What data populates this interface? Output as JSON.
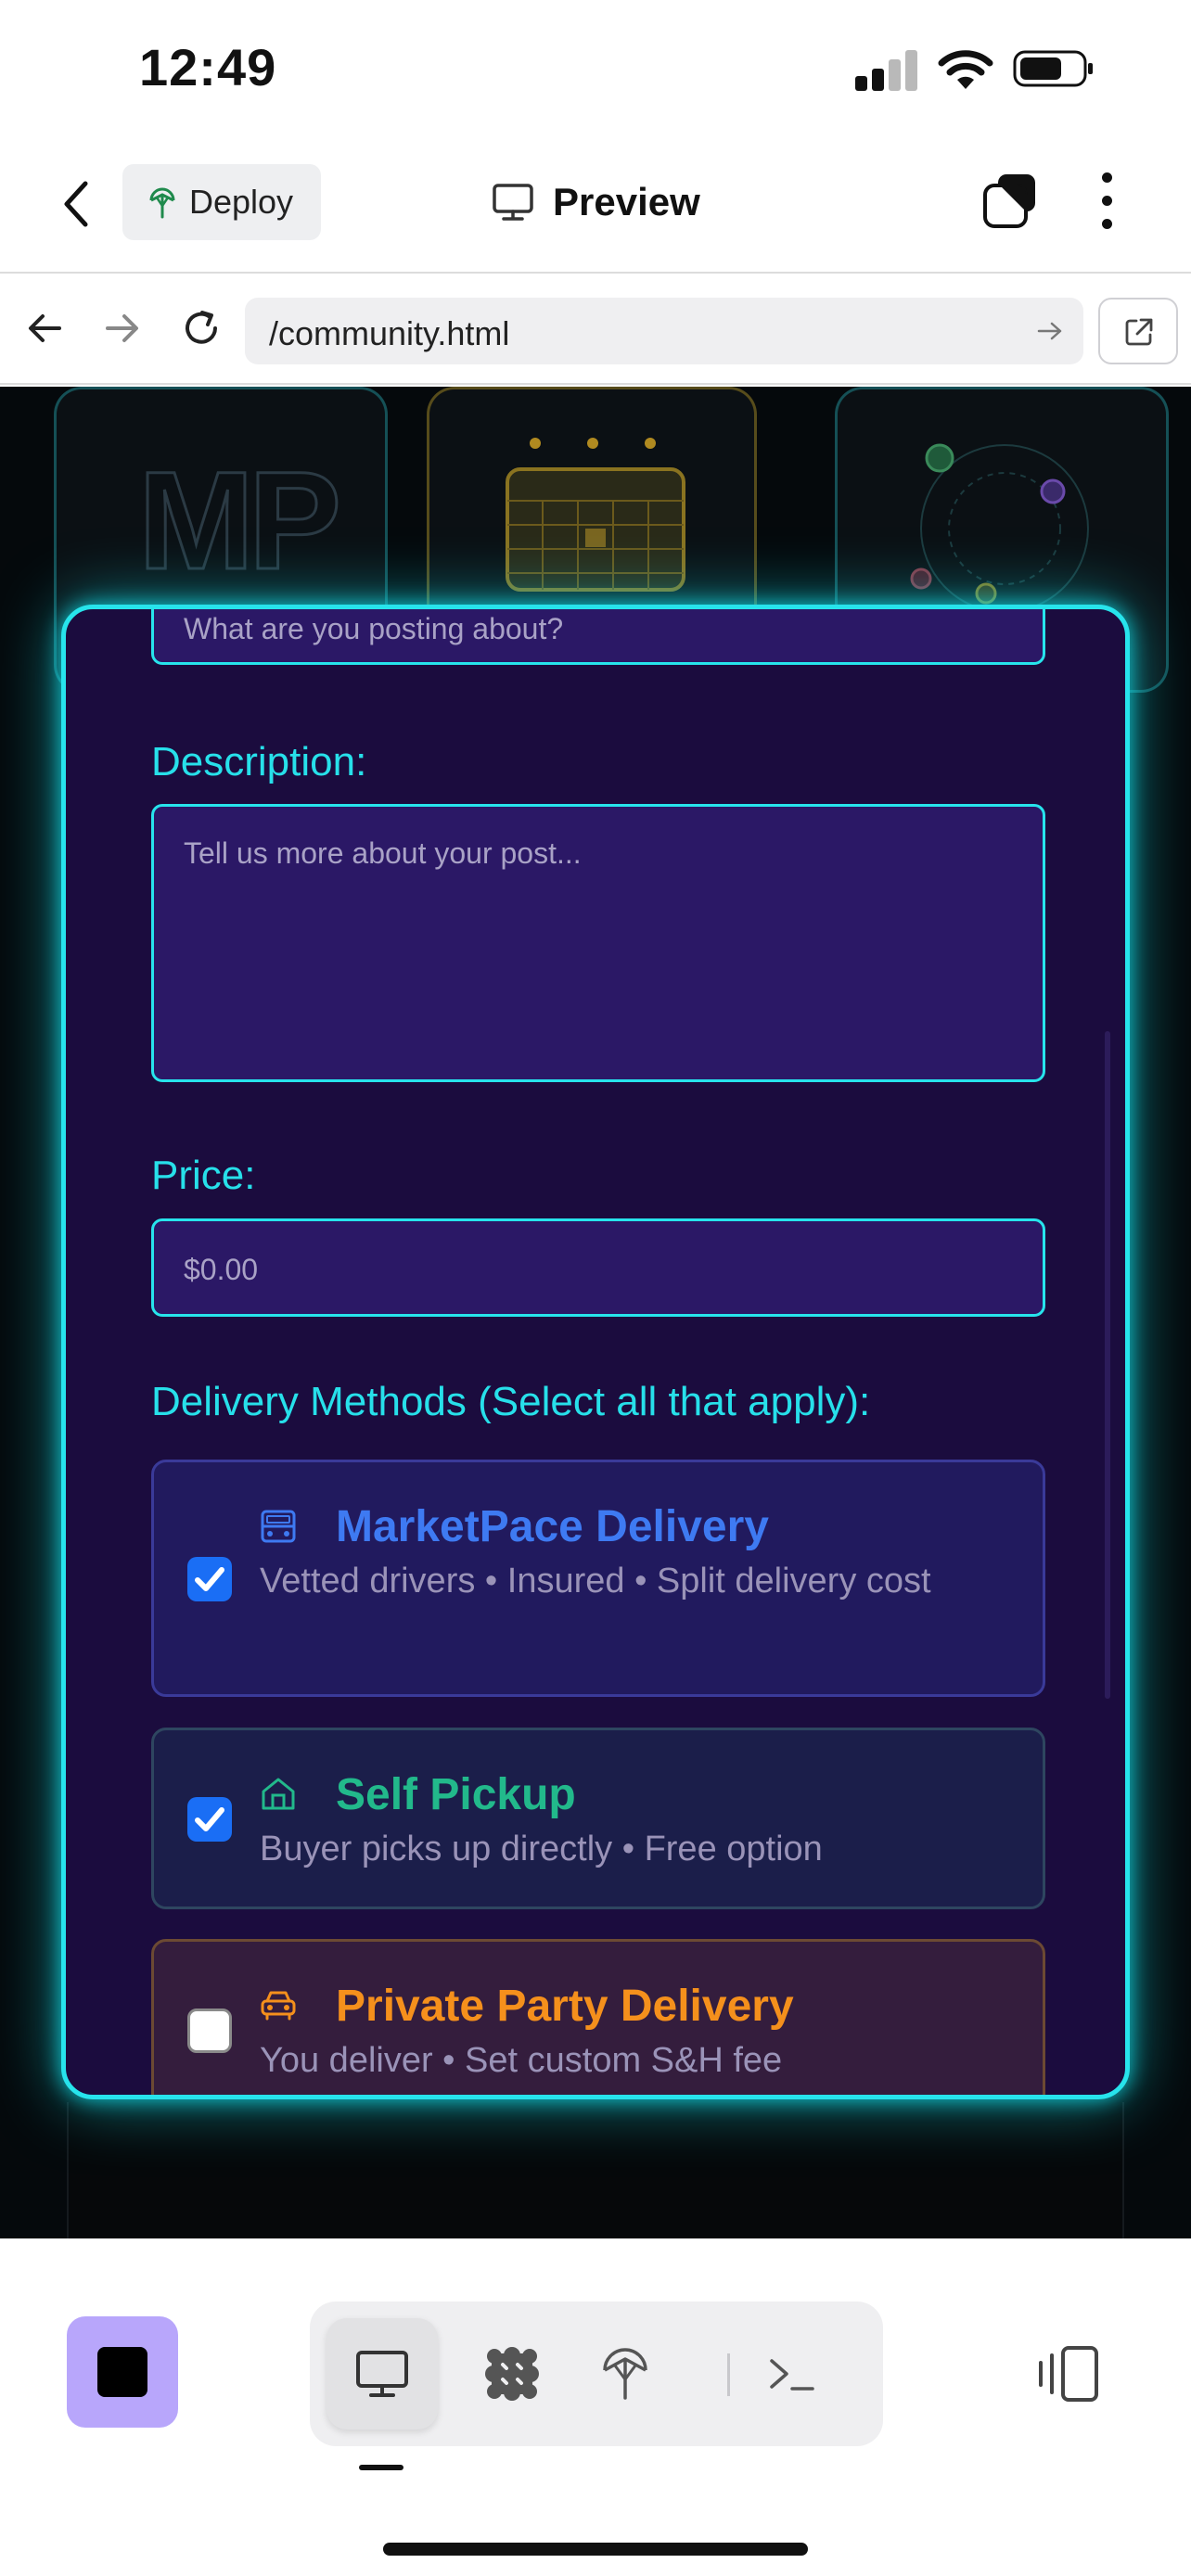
{
  "status_bar": {
    "time": "12:49"
  },
  "toolbar": {
    "deploy_label": "Deploy",
    "preview_label": "Preview"
  },
  "browser": {
    "url": "/community.html"
  },
  "form": {
    "title_placeholder": "What are you posting about?",
    "description_label": "Description:",
    "description_placeholder": "Tell us more about your post...",
    "price_label": "Price:",
    "price_placeholder": "$0.00",
    "delivery_label": "Delivery Methods (Select all that apply):",
    "options": [
      {
        "title": "MarketPace Delivery",
        "description": "Vetted drivers • Insured • Split delivery cost",
        "checked": true,
        "icon": "truck-icon",
        "color": "#3e7af2"
      },
      {
        "title": "Self Pickup",
        "description": "Buyer picks up directly • Free option",
        "checked": true,
        "icon": "house-icon",
        "color": "#22b98b"
      },
      {
        "title": "Private Party Delivery",
        "description": "You deliver • Set custom S&H fee",
        "checked": false,
        "icon": "car-icon",
        "color": "#f5901c"
      }
    ]
  },
  "background": {
    "logo_text": "MP"
  },
  "colors": {
    "accent": "#27e4ec",
    "modal_bg": "#1b0c3e",
    "input_bg": "#2b1866",
    "stop_button": "#b8a6fb"
  }
}
